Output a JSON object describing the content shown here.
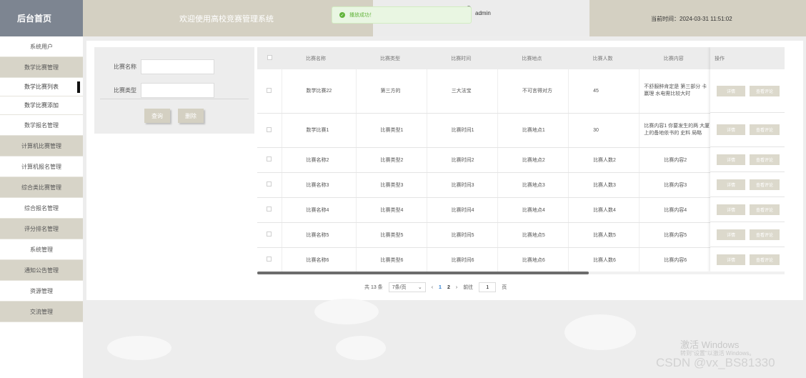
{
  "sidebar": {
    "title": "后台首页",
    "items": [
      {
        "label": "系统用户",
        "style": "plain"
      },
      {
        "label": "数学比赛管理",
        "style": "dark"
      },
      {
        "label": "数学比赛列表",
        "style": "sub",
        "active": true
      },
      {
        "label": "数学比赛添加",
        "style": "sub"
      },
      {
        "label": "数学报名管理",
        "style": "plain"
      },
      {
        "label": "计算机比赛管理",
        "style": "dark"
      },
      {
        "label": "计算机报名管理",
        "style": "plain"
      },
      {
        "label": "综合类比赛管理",
        "style": "dark"
      },
      {
        "label": "综合报名管理",
        "style": "plain"
      },
      {
        "label": "评分排名管理",
        "style": "dark"
      },
      {
        "label": "系统管理",
        "style": "plain"
      },
      {
        "label": "通知公告管理",
        "style": "dark"
      },
      {
        "label": "资源管理",
        "style": "plain"
      },
      {
        "label": "交流管理",
        "style": "dark"
      }
    ]
  },
  "header": {
    "title": "欢迎使用高校竞赛管理系统",
    "username": "admin",
    "time": "当前时间：2024-03-31 11:51:02"
  },
  "toast": {
    "message": "播放成功！"
  },
  "filter": {
    "name_label": "比赛名称",
    "name_value": "",
    "type_label": "比赛类型",
    "type_value": "",
    "search_label": "查询",
    "delete_label": "删除"
  },
  "table": {
    "columns": [
      "比赛名称",
      "比赛类型",
      "比赛时间",
      "比赛地点",
      "比赛人数",
      "比赛内容"
    ],
    "ops_header": "操作",
    "detail_label": "详情",
    "review_label": "查看评论",
    "rows": [
      {
        "cells": [
          "数学比赛22",
          "第三方的",
          "三大法宝",
          "不可言得对方",
          "45",
          "不舒服醉肯定是 第三部分 卡赢理 水电需比较大时"
        ]
      },
      {
        "cells": [
          "数学比赛1",
          "比赛类型1",
          "比赛时间1",
          "比赛地点1",
          "30",
          "比赛内容1 你要发生的两 大厦 上的备地依书的 史料 局略"
        ]
      },
      {
        "cells": [
          "比赛名称2",
          "比赛类型2",
          "比赛时间2",
          "比赛地点2",
          "比赛人数2",
          "比赛内容2"
        ]
      },
      {
        "cells": [
          "比赛名称3",
          "比赛类型3",
          "比赛时间3",
          "比赛地点3",
          "比赛人数3",
          "比赛内容3"
        ]
      },
      {
        "cells": [
          "比赛名称4",
          "比赛类型4",
          "比赛时间4",
          "比赛地点4",
          "比赛人数4",
          "比赛内容4"
        ]
      },
      {
        "cells": [
          "比赛名称5",
          "比赛类型5",
          "比赛时间5",
          "比赛地点5",
          "比赛人数5",
          "比赛内容5"
        ]
      },
      {
        "cells": [
          "比赛名称6",
          "比赛类型6",
          "比赛时间6",
          "比赛地点6",
          "比赛人数6",
          "比赛内容6"
        ]
      }
    ]
  },
  "pagination": {
    "total": "共 13 条",
    "page_size": "7条/页",
    "prev": "‹",
    "next": "›",
    "pages": [
      "1",
      "2"
    ],
    "current": "1",
    "goto_label": "前往",
    "goto_value": "1",
    "page_suffix": "页"
  },
  "watermark": {
    "activate_title": "激活 Windows",
    "activate_sub": "转到\"设置\"以激活 Windows。",
    "csdn": "CSDN @vx_BS81330"
  },
  "colors": {
    "accent": "#d4d0c2",
    "sidebar_head": "#7d8591",
    "toast_green": "#62b43b"
  }
}
